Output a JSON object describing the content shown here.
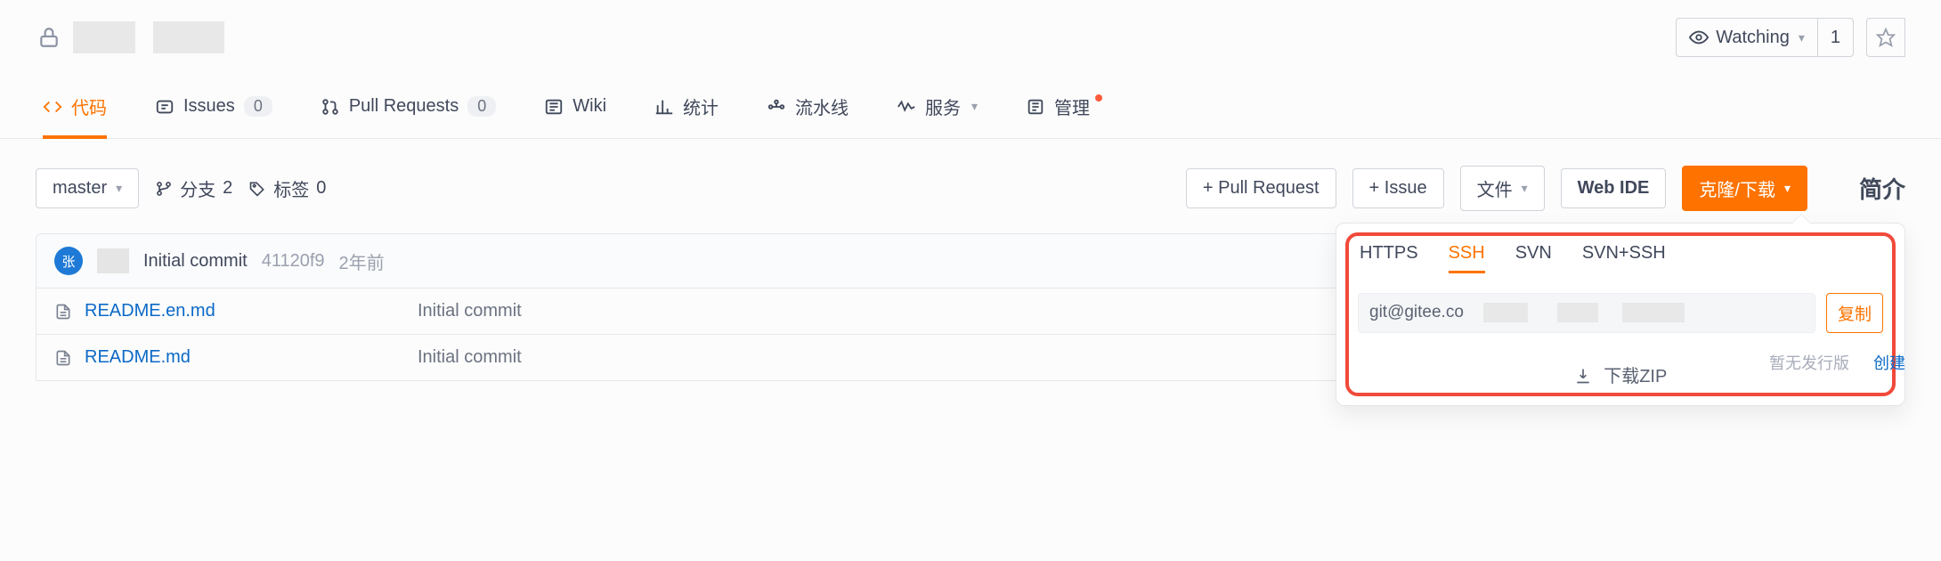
{
  "header": {
    "watching_label": "Watching",
    "watching_count": "1"
  },
  "nav": {
    "code": "代码",
    "issues": "Issues",
    "issues_count": "0",
    "pull_requests": "Pull Requests",
    "pr_count": "0",
    "wiki": "Wiki",
    "stats": "统计",
    "pipelines": "流水线",
    "services": "服务",
    "manage": "管理"
  },
  "toolbar": {
    "branch": "master",
    "branch_label": "分支",
    "branch_count": "2",
    "tag_label": "标签",
    "tag_count": "0",
    "pull_request": "+ Pull Request",
    "issue": "+ Issue",
    "file": "文件",
    "web_ide": "Web IDE",
    "clone": "克隆/下载",
    "intro": "简介"
  },
  "commit": {
    "avatar_text": "张",
    "message": "Initial commit",
    "sha": "41120f9",
    "time": "2年前"
  },
  "files": [
    {
      "name": "README.en.md",
      "commit": "Initial commit"
    },
    {
      "name": "README.md",
      "commit": "Initial commit"
    }
  ],
  "popover": {
    "tabs": {
      "https": "HTTPS",
      "ssh": "SSH",
      "svn": "SVN",
      "svn_ssh": "SVN+SSH"
    },
    "url": "git@gitee.co",
    "copy": "复制",
    "download_zip": "下载ZIP"
  },
  "footer": {
    "no_release": "暂无发行版",
    "create": "创建"
  }
}
